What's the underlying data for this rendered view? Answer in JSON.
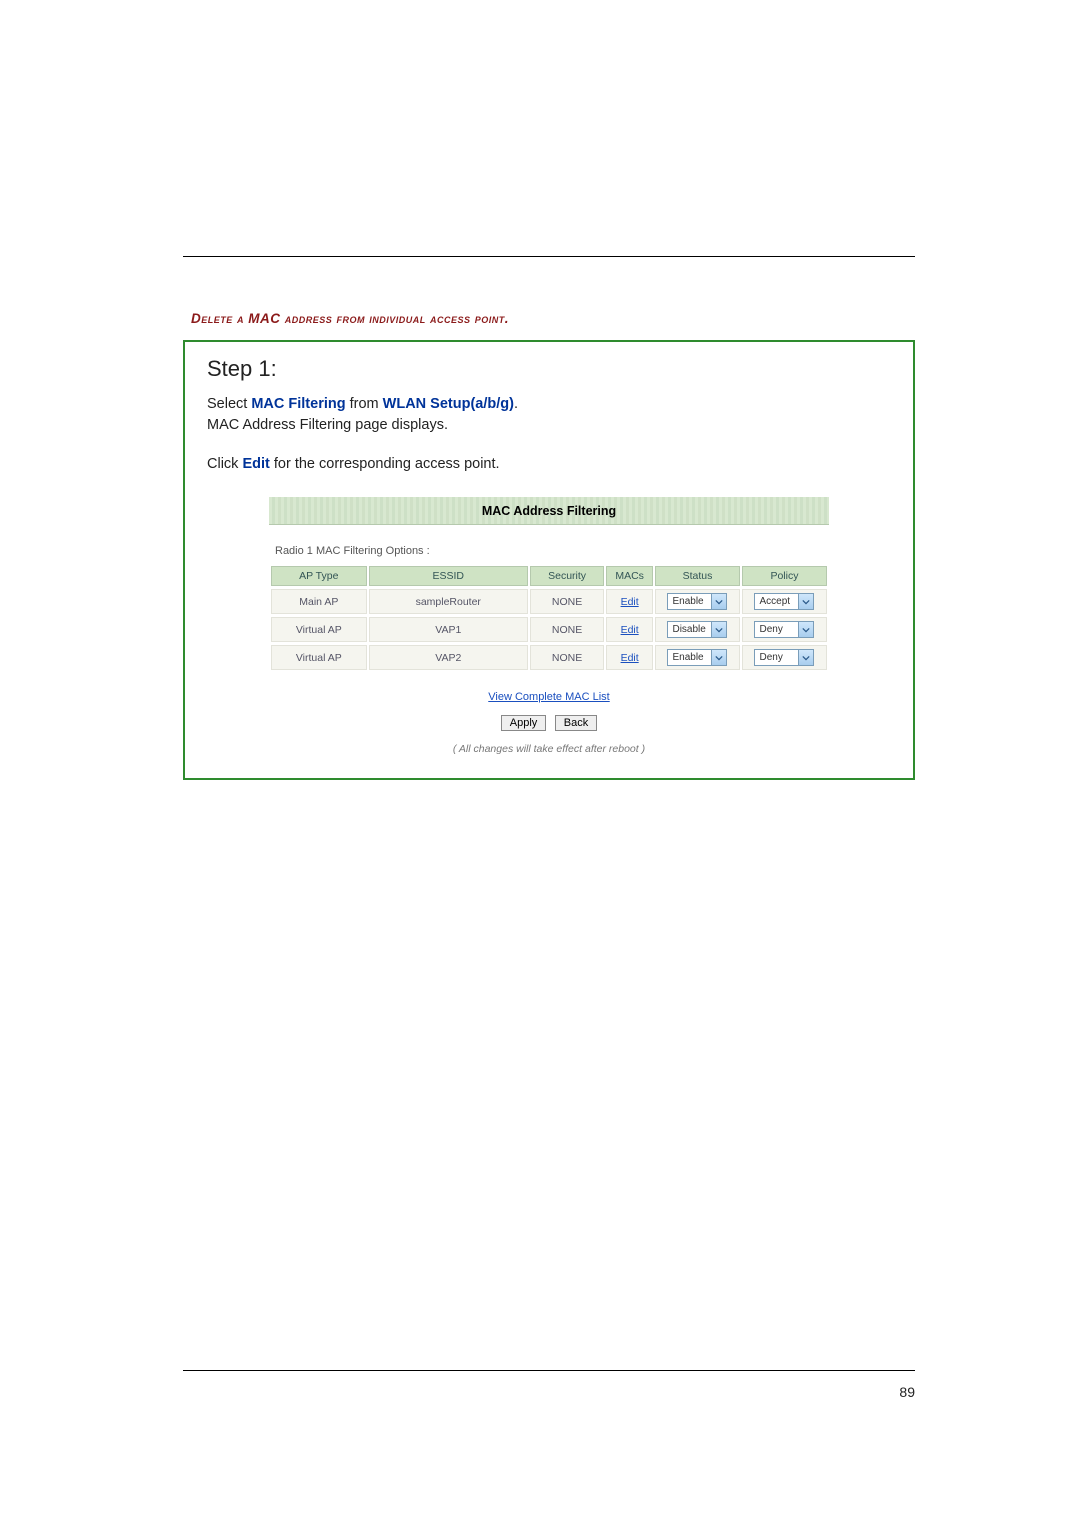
{
  "heading": "Delete a MAC address from individual access point.",
  "step_title": "Step 1:",
  "line1_a": "Select ",
  "line1_kw1": "MAC Filtering",
  "line1_b": " from ",
  "line1_kw2": "WLAN Setup(a/b/g)",
  "line1_c": ".",
  "line2": "MAC Address Filtering page displays.",
  "line3_a": "Click ",
  "line3_kw": "Edit",
  "line3_b": " for the corresponding access point.",
  "panel_title": "MAC Address Filtering",
  "options_label": "Radio 1 MAC Filtering Options :",
  "columns": {
    "ap_type": "AP Type",
    "essid": "ESSID",
    "security": "Security",
    "macs": "MACs",
    "status": "Status",
    "policy": "Policy"
  },
  "rows": [
    {
      "ap_type": "Main AP",
      "essid": "sampleRouter",
      "security": "NONE",
      "macs": "Edit",
      "status": "Enable",
      "policy": "Accept"
    },
    {
      "ap_type": "Virtual AP",
      "essid": "VAP1",
      "security": "NONE",
      "macs": "Edit",
      "status": "Disable",
      "policy": "Deny"
    },
    {
      "ap_type": "Virtual AP",
      "essid": "VAP2",
      "security": "NONE",
      "macs": "Edit",
      "status": "Enable",
      "policy": "Deny"
    }
  ],
  "view_list": "View Complete MAC List",
  "apply_btn": "Apply",
  "back_btn": "Back",
  "footnote": "( All changes will take effect after reboot )",
  "page_number": "89"
}
